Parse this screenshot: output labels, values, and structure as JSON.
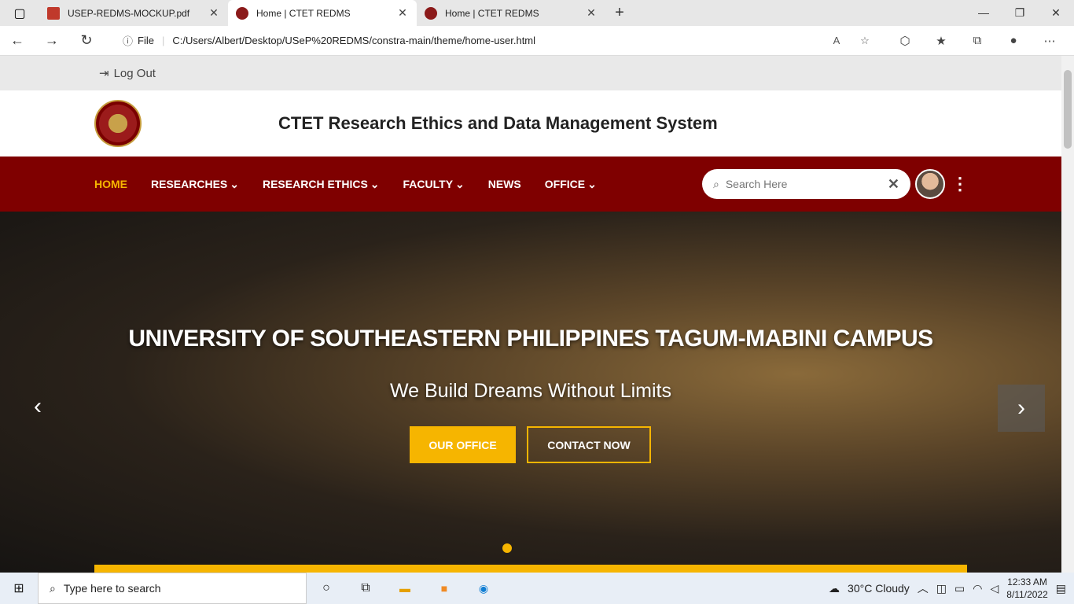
{
  "browser": {
    "tabs": [
      {
        "title": "USEP-REDMS-MOCKUP.pdf",
        "favicon_color": "#c0392b"
      },
      {
        "title": "Home | CTET REDMS",
        "favicon_color": "#8b1a1a"
      },
      {
        "title": "Home | CTET REDMS",
        "favicon_color": "#8b1a1a"
      }
    ],
    "new_tab": "+",
    "info_label": "File",
    "url": "C:/Users/Albert/Desktop/USeP%20REDMS/constra-main/theme/home-user.html"
  },
  "topbar": {
    "logout_label": "Log Out"
  },
  "header": {
    "title": "CTET Research Ethics and Data Management System"
  },
  "nav": {
    "items": [
      {
        "label": "HOME",
        "active": true,
        "dropdown": false
      },
      {
        "label": "RESEARCHES",
        "active": false,
        "dropdown": true
      },
      {
        "label": "RESEARCH ETHICS",
        "active": false,
        "dropdown": true
      },
      {
        "label": "FACULTY",
        "active": false,
        "dropdown": true
      },
      {
        "label": "NEWS",
        "active": false,
        "dropdown": false
      },
      {
        "label": "OFFICE",
        "active": false,
        "dropdown": true
      }
    ],
    "search_placeholder": "Search Here",
    "accent_color": "#7f0000",
    "active_color": "#f6b500"
  },
  "hero": {
    "heading": "UNIVERSITY OF SOUTHEASTERN PHILIPPINES TAGUM-MABINI CAMPUS",
    "subheading": "We Build Dreams Without Limits",
    "primary_button": "OUR OFFICE",
    "secondary_button": "CONTACT NOW"
  },
  "taskbar": {
    "search_placeholder": "Type here to search",
    "weather": "30°C  Cloudy",
    "time": "12:33 AM",
    "date": "8/11/2022"
  }
}
